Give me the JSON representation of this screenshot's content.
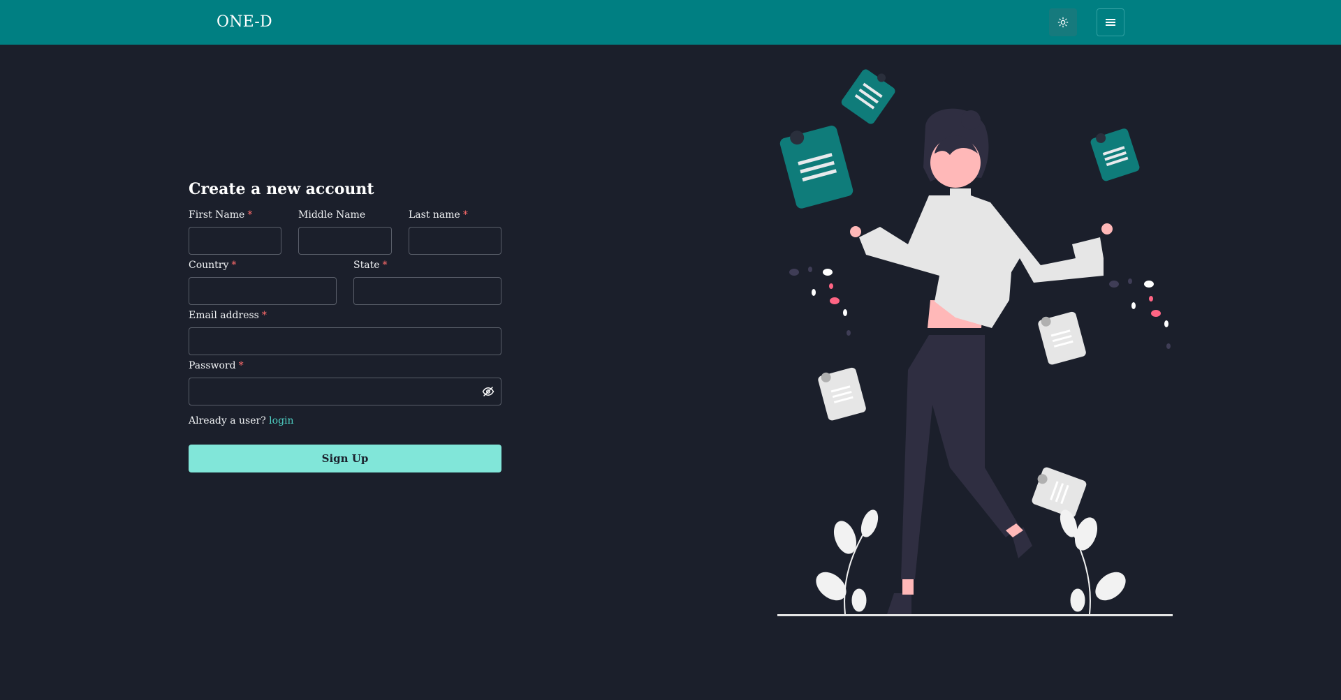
{
  "navbar": {
    "brand": "ONE-D",
    "theme_toggle_icon": "sun-icon",
    "menu_icon": "hamburger-icon",
    "color": "#007f82"
  },
  "form": {
    "title": "Create a new account",
    "required_mark": "*",
    "fields": {
      "first_name": {
        "label": "First Name",
        "value": ""
      },
      "middle_name": {
        "label": "Middle Name",
        "value": ""
      },
      "last_name": {
        "label": "Last name",
        "value": ""
      },
      "country": {
        "label": "Country",
        "value": ""
      },
      "state": {
        "label": "State",
        "value": ""
      },
      "email": {
        "label": "Email address",
        "value": ""
      },
      "password": {
        "label": "Password",
        "value": "",
        "toggle_icon": "eye-off-icon"
      }
    },
    "already_text": "Already a user?",
    "login_link": "login",
    "submit_label": "Sign Up"
  },
  "colors": {
    "background": "#1b1f2b",
    "accent": "#81e6d9",
    "link": "#4fd1c5",
    "required": "#ff6b6b"
  }
}
